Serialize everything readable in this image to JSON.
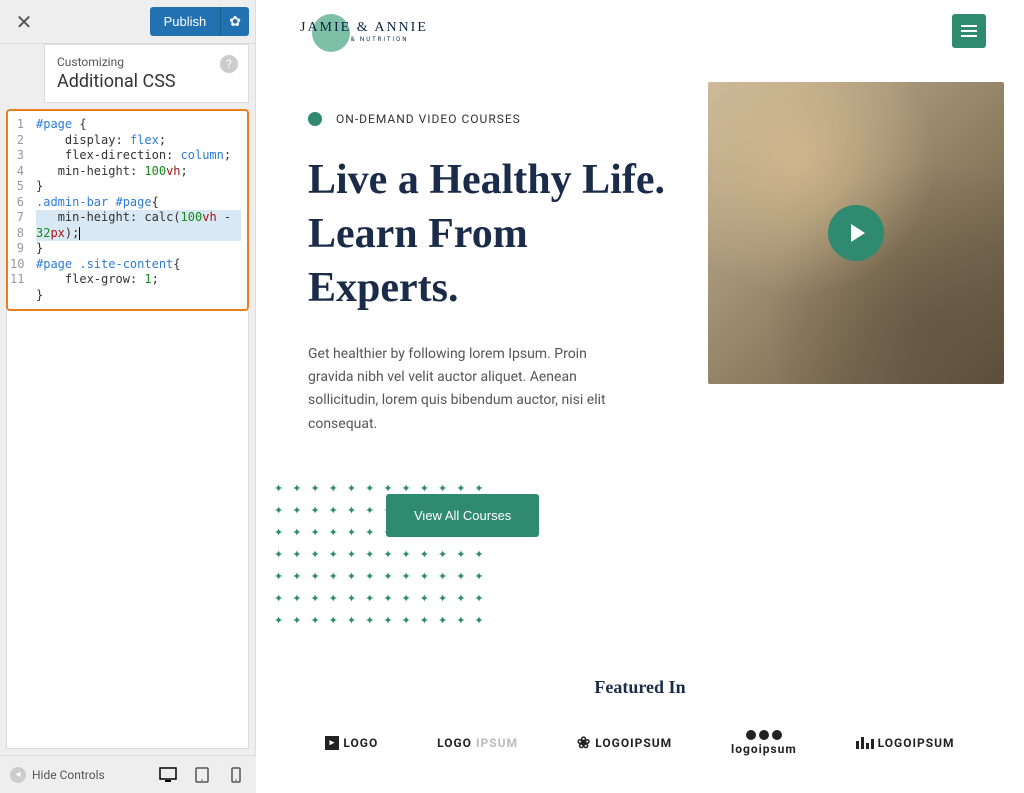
{
  "customizer": {
    "publish_label": "Publish",
    "customizing_label": "Customizing",
    "panel_title": "Additional CSS",
    "hide_controls_label": "Hide Controls"
  },
  "code": {
    "lines": [
      {
        "n": 1,
        "segs": [
          [
            "sel",
            "#page"
          ],
          [
            "punc",
            " {"
          ]
        ]
      },
      {
        "n": 2,
        "segs": [
          [
            "punc",
            "    "
          ],
          [
            "prop",
            "display"
          ],
          [
            "punc",
            ": "
          ],
          [
            "kw",
            "flex"
          ],
          [
            "punc",
            ";"
          ]
        ]
      },
      {
        "n": 3,
        "segs": [
          [
            "punc",
            "    "
          ],
          [
            "prop",
            "flex-direction"
          ],
          [
            "punc",
            ": "
          ],
          [
            "kw",
            "column"
          ],
          [
            "punc",
            ";"
          ]
        ]
      },
      {
        "n": 4,
        "segs": [
          [
            "punc",
            "   "
          ],
          [
            "prop",
            "min-height"
          ],
          [
            "punc",
            ": "
          ],
          [
            "num",
            "100"
          ],
          [
            "unit",
            "vh"
          ],
          [
            "punc",
            ";"
          ]
        ]
      },
      {
        "n": 5,
        "segs": [
          [
            "punc",
            "}"
          ]
        ]
      },
      {
        "n": 6,
        "segs": [
          [
            "sel",
            ".admin-bar #page"
          ],
          [
            "punc",
            "{"
          ]
        ]
      },
      {
        "n": 7,
        "hl": true,
        "segs": [
          [
            "punc",
            "   "
          ],
          [
            "prop",
            "min-height"
          ],
          [
            "punc",
            ": "
          ],
          [
            "fn",
            "calc"
          ],
          [
            "punc",
            "("
          ],
          [
            "num",
            "100"
          ],
          [
            "unit",
            "vh"
          ],
          [
            "punc",
            " - "
          ],
          [
            "num",
            "32"
          ],
          [
            "unit",
            "px"
          ],
          [
            "punc",
            ");"
          ]
        ],
        "cursor": true
      },
      {
        "n": 8,
        "segs": [
          [
            "punc",
            "}"
          ]
        ]
      },
      {
        "n": 9,
        "segs": [
          [
            "sel",
            "#page .site-content"
          ],
          [
            "punc",
            "{"
          ]
        ]
      },
      {
        "n": 10,
        "segs": [
          [
            "punc",
            "    "
          ],
          [
            "prop",
            "flex-grow"
          ],
          [
            "punc",
            ": "
          ],
          [
            "num",
            "1"
          ],
          [
            "punc",
            ";"
          ]
        ]
      },
      {
        "n": 11,
        "segs": [
          [
            "punc",
            "}"
          ]
        ]
      }
    ]
  },
  "site": {
    "logo_line1": "JAMIE & ANNIE",
    "logo_line2": "HEALTH & NUTRITION",
    "eyebrow": "ON-DEMAND VIDEO COURSES",
    "hero_title": "Live a Healthy Life. Learn From Experts.",
    "hero_desc": "Get healthier by following lorem Ipsum. Proin gravida nibh vel velit auctor aliquet. Aenean sollicitudin, lorem quis bibendum auctor, nisi elit consequat.",
    "cta_label": "View All Courses",
    "featured_title": "Featured In",
    "logos": [
      "LOGO",
      "LOGOIPSUM",
      "LOGOIPSUM",
      "logoipsum",
      "LOGOIPSUM"
    ]
  }
}
